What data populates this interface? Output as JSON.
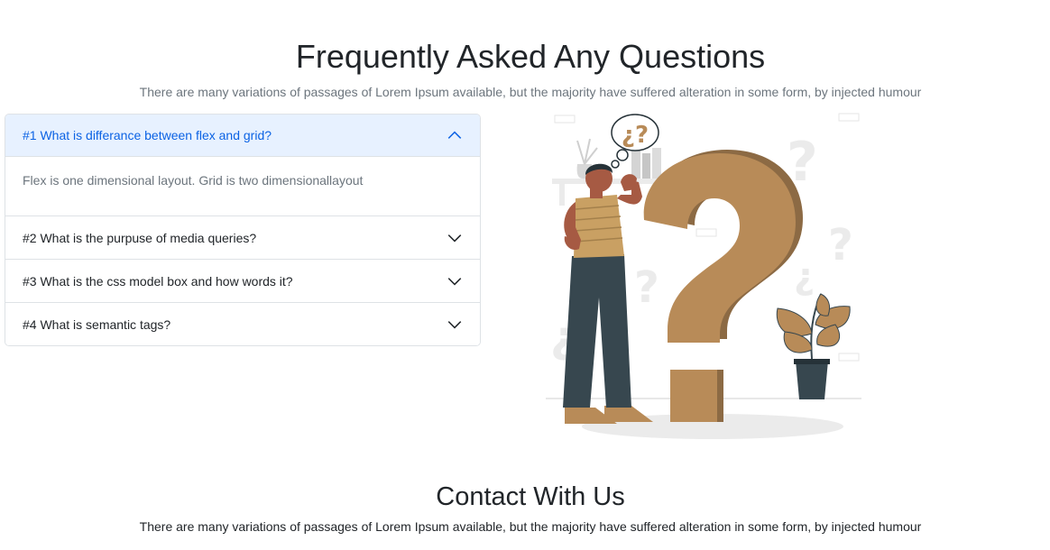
{
  "faq": {
    "title": "Frequently Asked Any Questions",
    "subtitle": "There are many variations of passages of Lorem Ipsum available, but the majority have suffered alteration in some form, by injected humour",
    "items": [
      {
        "question": "#1 What is differance between flex and grid?",
        "answer": "Flex is one dimensional layout. Grid is two dimensionallayout",
        "expanded": true
      },
      {
        "question": "#2 What is the purpuse of media queries?",
        "expanded": false
      },
      {
        "question": "#3 What is the css model box and how words it?",
        "expanded": false
      },
      {
        "question": "#4 What is semantic tags?",
        "expanded": false
      }
    ]
  },
  "illustration": {
    "thought_bubble": "¿?",
    "icon": "question-mark-person-illustration"
  },
  "contact": {
    "title": "Contact With Us",
    "subtitle": "There are many variations of passages of Lorem Ipsum available, but the majority have suffered alteration in some form, by injected humour"
  },
  "colors": {
    "accent": "#0c63e4",
    "accent_bg": "#e7f1ff",
    "question_mark": "#b88b58",
    "pants": "#37474f"
  }
}
